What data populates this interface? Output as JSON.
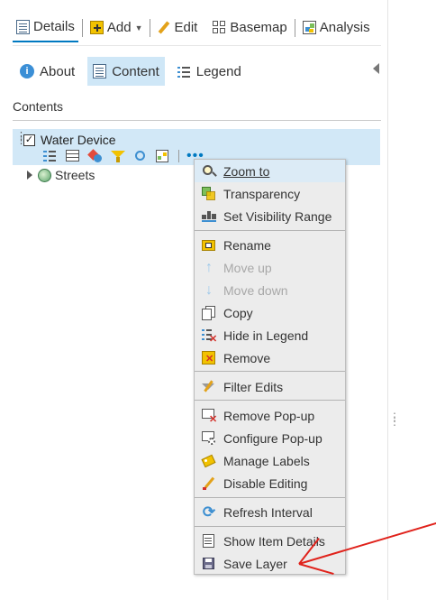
{
  "toolbar": {
    "details": "Details",
    "add": "Add",
    "edit": "Edit",
    "basemap": "Basemap",
    "analysis": "Analysis"
  },
  "tabs": {
    "about": "About",
    "content": "Content",
    "legend": "Legend"
  },
  "contents_title": "Contents",
  "layers": [
    {
      "name": "Water Device",
      "checked": true,
      "selected": true
    },
    {
      "name": "Streets",
      "checked": false,
      "selected": false
    }
  ],
  "menu": {
    "zoom_to": "Zoom to",
    "transparency": "Transparency",
    "set_visibility_range": "Set Visibility Range",
    "rename": "Rename",
    "move_up": "Move up",
    "move_down": "Move down",
    "copy": "Copy",
    "hide_in_legend": "Hide in Legend",
    "remove": "Remove",
    "filter_edits": "Filter Edits",
    "remove_popup": "Remove Pop-up",
    "configure_popup": "Configure Pop-up",
    "manage_labels": "Manage Labels",
    "disable_editing": "Disable Editing",
    "refresh_interval": "Refresh Interval",
    "show_item_details": "Show Item Details",
    "save_layer": "Save Layer"
  },
  "colors": {
    "accent": "#0079c1",
    "selected_bg": "#d2e8f7",
    "tab_active_bg": "#cfe7f7",
    "annotation": "#e0221b"
  }
}
